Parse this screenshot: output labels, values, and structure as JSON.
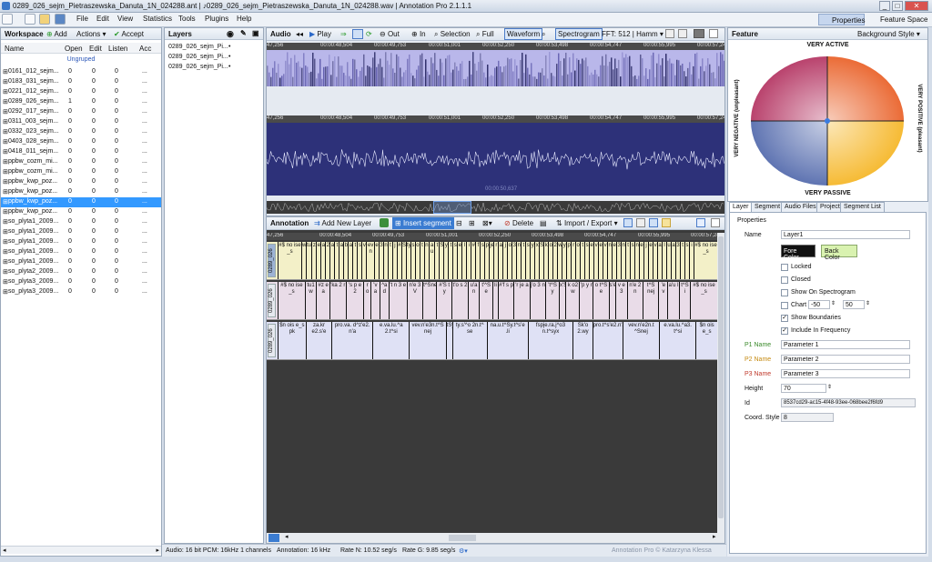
{
  "window": {
    "title": "0289_026_sejm_Pietraszewska_Danuta_1N_024288.ant | ♪0289_026_sejm_Pietraszewska_Danuta_1N_024288.wav | Annotation Pro 2.1.1.1",
    "minimize": "_",
    "maximize": "□",
    "close": "✕"
  },
  "menu": {
    "items": [
      "File",
      "Edit",
      "View",
      "Statistics",
      "Tools",
      "Plugins",
      "Help"
    ],
    "properties": "Properties",
    "feature_space": "Feature Space"
  },
  "workspace": {
    "title": "Workspace",
    "add": "Add",
    "actions": "Actions ▾",
    "accept": "Accept",
    "columns": [
      "Name",
      "Open",
      "Edit",
      "Listen",
      "Acc"
    ],
    "group": "Ungruped",
    "rows": [
      {
        "name": "0161_012_sejm...",
        "open": "0",
        "edit": "0",
        "listen": "0",
        "acc": "..."
      },
      {
        "name": "0183_031_sejm...",
        "open": "0",
        "edit": "0",
        "listen": "0",
        "acc": "..."
      },
      {
        "name": "0221_012_sejm...",
        "open": "0",
        "edit": "0",
        "listen": "0",
        "acc": "..."
      },
      {
        "name": "0289_026_sejm...",
        "open": "1",
        "edit": "0",
        "listen": "0",
        "acc": "..."
      },
      {
        "name": "0292_017_sejm...",
        "open": "0",
        "edit": "0",
        "listen": "0",
        "acc": "..."
      },
      {
        "name": "0311_003_sejm...",
        "open": "0",
        "edit": "0",
        "listen": "0",
        "acc": "..."
      },
      {
        "name": "0332_023_sejm...",
        "open": "0",
        "edit": "0",
        "listen": "0",
        "acc": "..."
      },
      {
        "name": "0403_028_sejm...",
        "open": "0",
        "edit": "0",
        "listen": "0",
        "acc": "..."
      },
      {
        "name": "0418_011_sejm...",
        "open": "0",
        "edit": "0",
        "listen": "0",
        "acc": "..."
      },
      {
        "name": "ppbw_cozm_mi...",
        "open": "0",
        "edit": "0",
        "listen": "0",
        "acc": "..."
      },
      {
        "name": "ppbw_cozm_mi...",
        "open": "0",
        "edit": "0",
        "listen": "0",
        "acc": "..."
      },
      {
        "name": "ppbw_kwp_poz...",
        "open": "0",
        "edit": "0",
        "listen": "0",
        "acc": "..."
      },
      {
        "name": "ppbw_kwp_poz...",
        "open": "0",
        "edit": "0",
        "listen": "0",
        "acc": "..."
      },
      {
        "name": "ppbw_kwp_poz...",
        "open": "0",
        "edit": "0",
        "listen": "0",
        "acc": "..."
      },
      {
        "name": "ppbw_kwp_poz...",
        "open": "0",
        "edit": "0",
        "listen": "0",
        "acc": "..."
      },
      {
        "name": "so_plyta1_2009...",
        "open": "0",
        "edit": "0",
        "listen": "0",
        "acc": "..."
      },
      {
        "name": "so_plyta1_2009...",
        "open": "0",
        "edit": "0",
        "listen": "0",
        "acc": "..."
      },
      {
        "name": "so_plyta1_2009...",
        "open": "0",
        "edit": "0",
        "listen": "0",
        "acc": "..."
      },
      {
        "name": "so_plyta1_2009...",
        "open": "0",
        "edit": "0",
        "listen": "0",
        "acc": "..."
      },
      {
        "name": "so_plyta1_2009...",
        "open": "0",
        "edit": "0",
        "listen": "0",
        "acc": "..."
      },
      {
        "name": "so_plyta2_2009...",
        "open": "0",
        "edit": "0",
        "listen": "0",
        "acc": "..."
      },
      {
        "name": "so_plyta3_2009...",
        "open": "0",
        "edit": "0",
        "listen": "0",
        "acc": "..."
      },
      {
        "name": "so_plyta3_2009...",
        "open": "0",
        "edit": "0",
        "listen": "0",
        "acc": "..."
      }
    ],
    "selected_index": 13
  },
  "layers": {
    "title": "Layers",
    "items": [
      "0289_026_sejm_Pi...",
      "0289_026_sejm_Pi...",
      "0289_026_sejm_Pi..."
    ]
  },
  "audio": {
    "title": "Audio",
    "play": "Play",
    "out": "Out",
    "in": "In",
    "selection": "Selection",
    "full": "Full",
    "waveform": "Waveform",
    "spectrogram": "Spectrogram",
    "fft": "FFT: 512 | Hamm ▾",
    "timestamps": [
      "47,256",
      "00:00:48,504",
      "00:00:49,753",
      "00:00:51,001",
      "00:00:52,250",
      "00:00:53,498",
      "00:00:54,747",
      "00:00:55,995",
      "00:00:57,24"
    ],
    "cursor_time": "00:00:50,637"
  },
  "annotation": {
    "title": "Annotation",
    "add_layer": "Add New Layer",
    "insert_segment": "Insert segment",
    "delete": "Delete",
    "import_export": "Import / Export ▾",
    "tier_labels": [
      "0289_026",
      "0289_026",
      "0289_026"
    ],
    "tier1": [
      "#$ no ise _s",
      "w",
      "tu1",
      "z",
      "e",
      "a",
      "2",
      "a",
      "t",
      "a",
      "b",
      "a",
      "t",
      "s",
      "v",
      "ev n",
      "e",
      "3",
      "n",
      "t",
      "j",
      "#",
      "S",
      "ty",
      "s",
      "o",
      "t",
      "n",
      "a u",
      "t",
      "S",
      "y",
      "t",
      "s",
      "e",
      "l",
      "i",
      "#",
      "f",
      "s",
      "p",
      "je",
      "r",
      "a",
      "j",
      "o",
      "3",
      "n",
      "t",
      "s",
      "y",
      "x",
      "S",
      "k",
      "o",
      "2",
      "w",
      "y",
      "p",
      "r",
      "o",
      "t",
      "s",
      "e",
      "v",
      "e",
      "v",
      "n",
      "e",
      "3",
      "n",
      "t",
      "s",
      "n",
      "e",
      "j",
      "e",
      "v",
      "a",
      "l",
      "u",
      "a",
      "3",
      "t",
      "s",
      "i",
      "#$ no ise _s"
    ],
    "tier2": [
      "#$ no ise _s",
      "tu1 w",
      "#z e a",
      "'ka 2 r",
      "'s p e 2",
      "r o",
      "'v a",
      "^a d",
      "'t n 3 e",
      "n'e 3 V",
      "t^Snej",
      "#'S t y",
      "t'o s 2",
      "u'a n",
      "t'^S e",
      "li",
      "#'f s p",
      "'r je a",
      "j'o 3 n",
      "'t^S y",
      "x'S",
      "k o2 w",
      "'p y r",
      "o t^S e",
      "s'e",
      "v e 3",
      "n'e 2 n",
      "t^S nej",
      "'e v",
      "a'u l",
      "t^S i",
      "#$ no ise _s"
    ],
    "tier3": [
      "$n ois e_s pk",
      "za.kr e2.s'e",
      "pro.va. d^z'e2. n'a",
      "e.va.lu.^a 2.t^si",
      "vev.n'e3n.t^S nej",
      "tSy",
      "ty.s'^o 2n.t^ se",
      "na.u.t^Sy.t^s'e .li",
      "fspje.ra.j^o3 n.t^syx",
      "Sk'o 2.wy",
      "pro.t^s'e2.n'a",
      "vev.n'e2n.t ^Snej",
      "e.va.lu.^a3. t^si",
      "$n ois e_s"
    ]
  },
  "feature": {
    "title": "Feature",
    "background_style": "Background Style ▾",
    "top_label": "VERY ACTIVE",
    "bottom_label": "VERY PASSIVE",
    "left_label": "VERY NEGATIVE (unpleasant)",
    "right_label": "VERY POSITIVE (pleasant)"
  },
  "properties_panel": {
    "tabs": [
      "Layer",
      "Segment",
      "Audio Files",
      "Project",
      "Segment List"
    ],
    "group": "Properties",
    "name_label": "Name",
    "name_value": "Layer1",
    "fore_color": "Fore Color",
    "back_color": "Back Color",
    "locked": "Locked",
    "closed": "Closed",
    "show_on_spectrogram": "Show On Spectrogram",
    "chart": "Chart",
    "chart_min": "-50",
    "chart_max": "50",
    "show_boundaries": "Show Boundaries",
    "include_in_frequency": "Include In Frequency",
    "p1_label": "P1 Name",
    "p1_value": "Parameter 1",
    "p2_label": "P2 Name",
    "p2_value": "Parameter 2",
    "p3_label": "P3 Name",
    "p3_value": "Parameter 3",
    "height_label": "Height",
    "height_value": "70",
    "id_label": "Id",
    "id_value": "8537cd29-ac15-4f48-93ee-068bee2f6fd9",
    "coord_label": "Coord. Style",
    "coord_value": "8",
    "checks": {
      "locked": false,
      "closed": false,
      "show_on_spectrogram": false,
      "chart": false,
      "show_boundaries": true,
      "include_in_frequency": true
    }
  },
  "status": {
    "audio_info": "Audio: 16 bit PCM: 16kHz 1 channels",
    "annotation_info": "Annotation: 16 kHz",
    "rate_n": "Rate N: 10.52 seg/s",
    "rate_g": "Rate G: 9.85 seg/s",
    "copyright": "Annotation Pro © Katarzyna Klessa"
  },
  "colors": {
    "selection": "#3399ff",
    "tier1_bg": "#f3f0c8",
    "tier2_bg": "#e9dce8",
    "tier3_bg": "#dfe1f5",
    "spectrogram": "#b9b7ea",
    "waveform": "#2d3179",
    "insert_segment_btn": "#3b7cd1"
  }
}
